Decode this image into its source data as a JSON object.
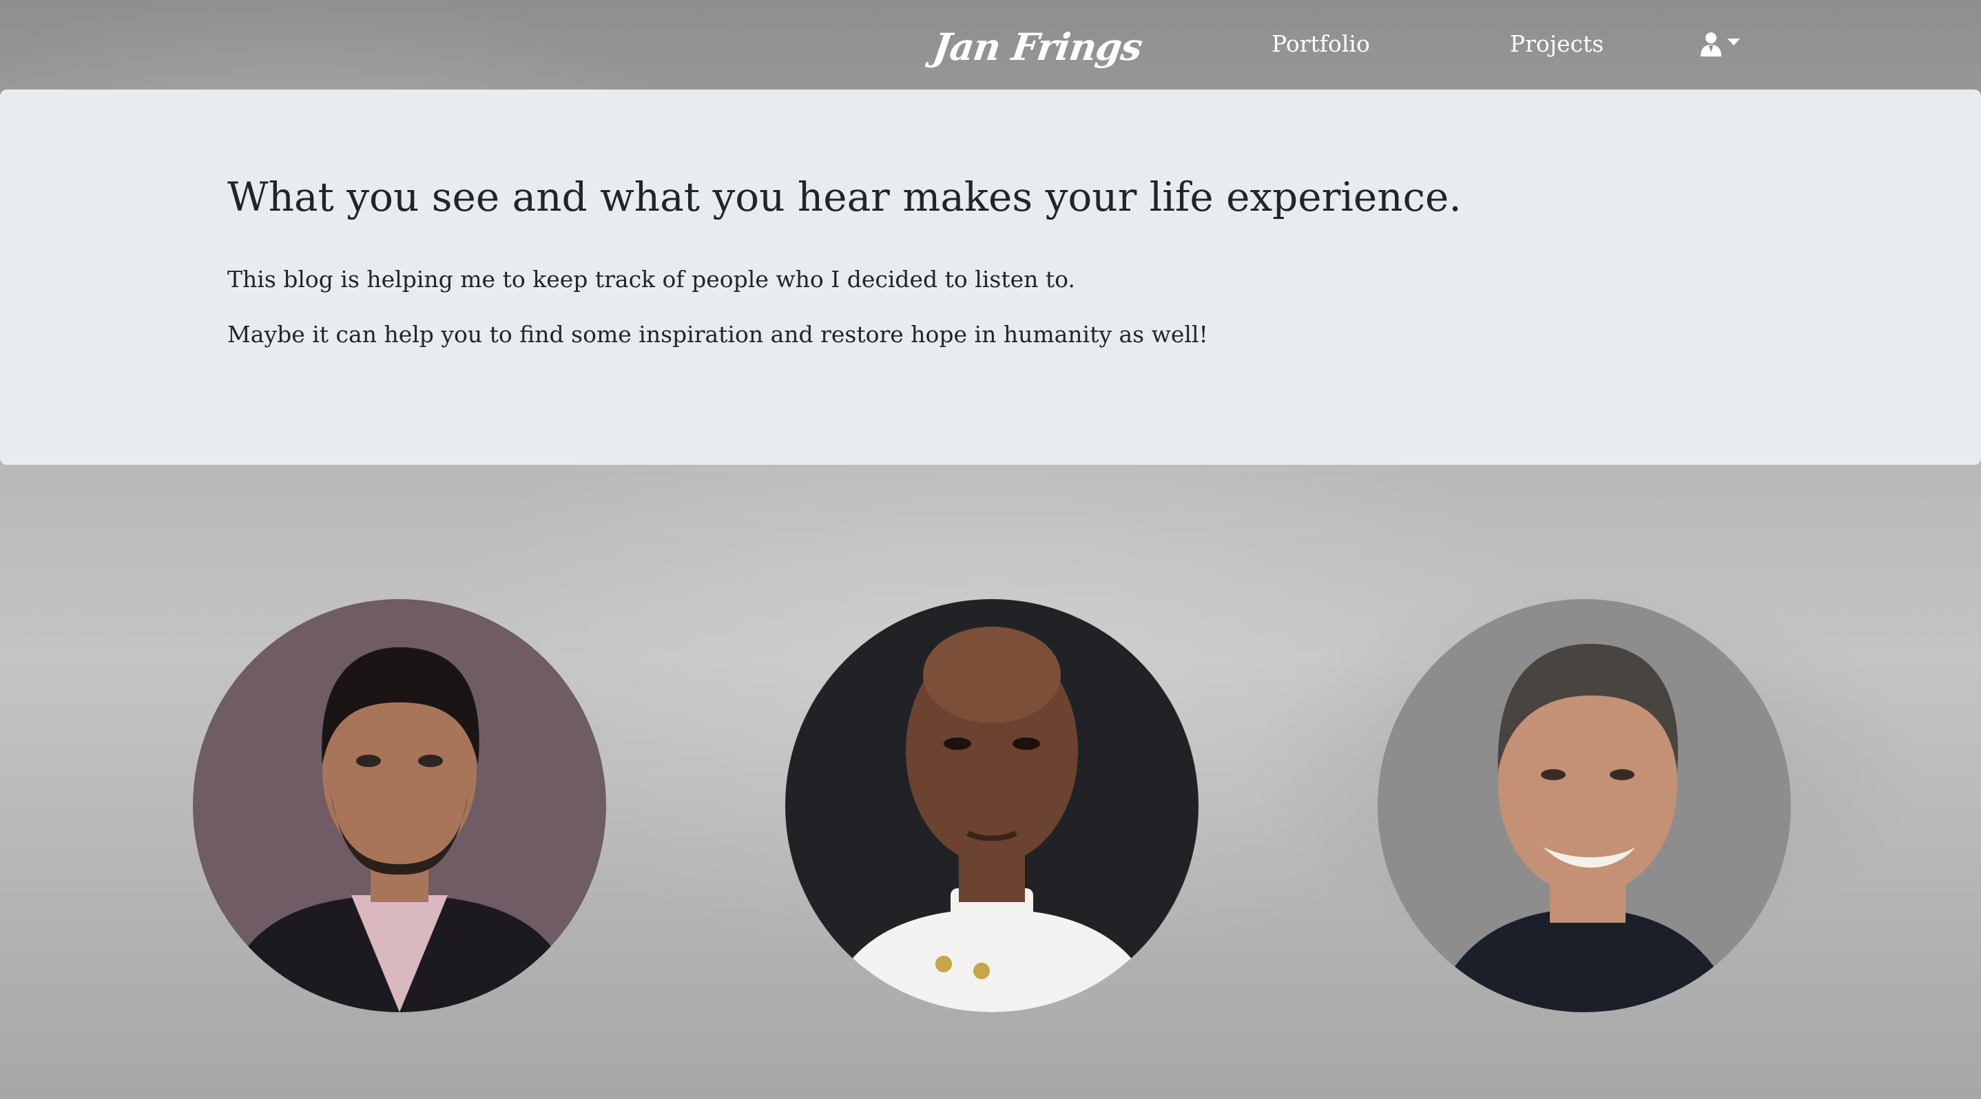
{
  "navbar": {
    "brand": "Jan Frings",
    "links": [
      {
        "label": "Portfolio"
      },
      {
        "label": "Projects"
      }
    ],
    "user_menu_icon": "user-icon"
  },
  "jumbotron": {
    "headline": "What you see and what you hear makes your life experience.",
    "paragraphs": [
      "This blog is helping me to keep track of people who I decided to listen to.",
      "Maybe it can help you to find some inspiration and restore hope in humanity as well!"
    ]
  },
  "portraits": [
    {
      "background": "#6f5c64",
      "clothing": "#1c1a20",
      "shirt": "#d9b8c0",
      "skin": "#a8755a",
      "hair": "#1a1514"
    },
    {
      "background": "#202226",
      "clothing": "#f2f2f0",
      "shirt": "#f2f2f0",
      "skin": "#6b4330",
      "hair": "#6b4330"
    },
    {
      "background": "#8d8d8d",
      "clothing": "#1a1f2a",
      "shirt": "#1a1f2a",
      "skin": "#c49176",
      "hair": "#4a4440"
    }
  ],
  "colors": {
    "jumbotron_bg": "#e9ecef",
    "text": "#212529",
    "nav_text": "#ffffff"
  }
}
